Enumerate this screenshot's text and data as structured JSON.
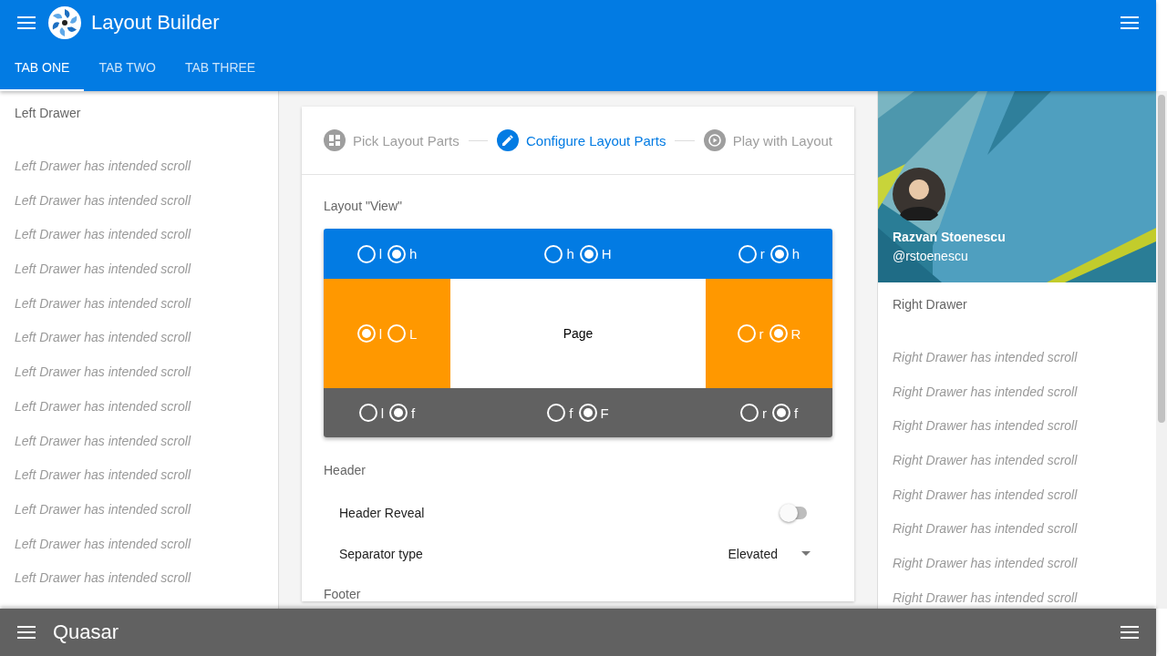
{
  "header": {
    "title": "Layout Builder"
  },
  "tabs": [
    {
      "label": "TAB ONE",
      "selected": true
    },
    {
      "label": "TAB TWO",
      "selected": false
    },
    {
      "label": "TAB THREE",
      "selected": false
    }
  ],
  "left_drawer": {
    "title": "Left Drawer",
    "items": [
      "Left Drawer has intended scroll",
      "Left Drawer has intended scroll",
      "Left Drawer has intended scroll",
      "Left Drawer has intended scroll",
      "Left Drawer has intended scroll",
      "Left Drawer has intended scroll",
      "Left Drawer has intended scroll",
      "Left Drawer has intended scroll",
      "Left Drawer has intended scroll",
      "Left Drawer has intended scroll",
      "Left Drawer has intended scroll",
      "Left Drawer has intended scroll",
      "Left Drawer has intended scroll"
    ]
  },
  "stepper": [
    {
      "kind": "grid",
      "label": "Pick Layout Parts",
      "selected": false
    },
    {
      "kind": "edit",
      "label": "Configure Layout Parts",
      "selected": true
    },
    {
      "kind": "play",
      "label": "Play with Layout",
      "selected": false
    }
  ],
  "layout_view": {
    "label": "Layout \"View\"",
    "rows": [
      {
        "kind": "header",
        "cells": [
          {
            "options": [
              {
                "label": "l",
                "selected": false
              },
              {
                "label": "h",
                "selected": true
              }
            ]
          },
          {
            "options": [
              {
                "label": "h",
                "selected": false
              },
              {
                "label": "H",
                "selected": true
              }
            ]
          },
          {
            "options": [
              {
                "label": "r",
                "selected": false
              },
              {
                "label": "h",
                "selected": true
              }
            ]
          }
        ]
      },
      {
        "kind": "middle",
        "cells": [
          {
            "options": [
              {
                "label": "l",
                "selected": true
              },
              {
                "label": "L",
                "selected": false
              }
            ]
          },
          {
            "text": "Page"
          },
          {
            "options": [
              {
                "label": "r",
                "selected": false
              },
              {
                "label": "R",
                "selected": true
              }
            ]
          }
        ]
      },
      {
        "kind": "footer",
        "cells": [
          {
            "options": [
              {
                "label": "l",
                "selected": false
              },
              {
                "label": "f",
                "selected": true
              }
            ]
          },
          {
            "options": [
              {
                "label": "f",
                "selected": false
              },
              {
                "label": "F",
                "selected": true
              }
            ]
          },
          {
            "options": [
              {
                "label": "r",
                "selected": false
              },
              {
                "label": "f",
                "selected": true
              }
            ]
          }
        ]
      }
    ]
  },
  "header_section": {
    "title": "Header",
    "settings": [
      {
        "kind": "toggle",
        "label": "Header Reveal",
        "on": false
      },
      {
        "kind": "select",
        "label": "Separator type",
        "value": "Elevated"
      }
    ]
  },
  "footer_section": {
    "title": "Footer"
  },
  "right_drawer": {
    "profile": {
      "name": "Razvan Stoenescu",
      "handle": "@rstoenescu"
    },
    "title": "Right Drawer",
    "items": [
      "Right Drawer has intended scroll",
      "Right Drawer has intended scroll",
      "Right Drawer has intended scroll",
      "Right Drawer has intended scroll",
      "Right Drawer has intended scroll",
      "Right Drawer has intended scroll",
      "Right Drawer has intended scroll",
      "Right Drawer has intended scroll"
    ]
  },
  "footer": {
    "title": "Quasar"
  }
}
